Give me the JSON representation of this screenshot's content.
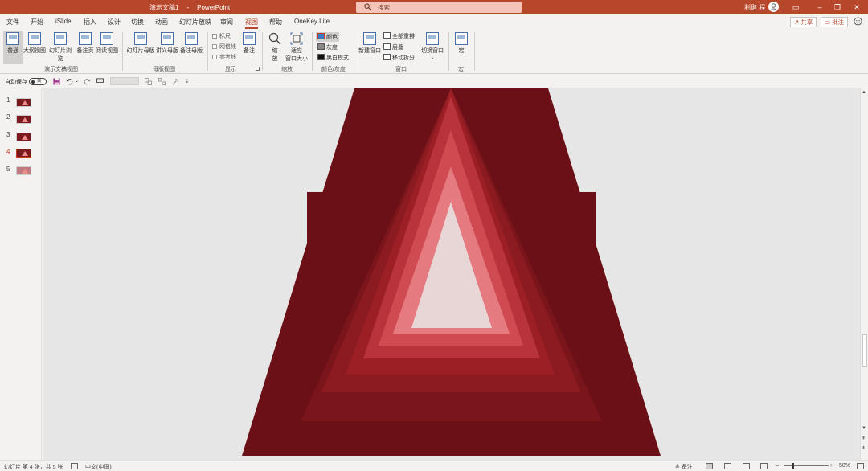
{
  "titlebar": {
    "doc_name": "演示文稿1",
    "separator": "-",
    "app_name": "PowerPoint",
    "search_placeholder": "搜索",
    "user_name": "利健 程",
    "accent": "#b7472a"
  },
  "tabs": [
    {
      "label": "文件"
    },
    {
      "label": "开始"
    },
    {
      "label": "iSlide"
    },
    {
      "label": "插入"
    },
    {
      "label": "设计"
    },
    {
      "label": "切换"
    },
    {
      "label": "动画"
    },
    {
      "label": "幻灯片放映"
    },
    {
      "label": "审阅"
    },
    {
      "label": "视图"
    },
    {
      "label": "帮助"
    },
    {
      "label": "OneKey Lite"
    }
  ],
  "active_tab": "视图",
  "share_label": "共享",
  "comment_label": "批注",
  "ribbon": {
    "presentation_views": {
      "buttons": [
        "普通",
        "大纲视图",
        "幻灯片浏览",
        "备注页",
        "阅读视图"
      ],
      "label": "演示文稿视图"
    },
    "master_views": {
      "buttons": [
        "幻灯片母版",
        "讲义母版",
        "备注母版"
      ],
      "label": "母版视图"
    },
    "show": {
      "checkboxes": [
        "标尺",
        "网格线",
        "参考线"
      ],
      "notes": "备注",
      "label": "显示"
    },
    "zoom": {
      "zoom_l1": "缩",
      "zoom_l2": "放",
      "fit_l1": "适应",
      "fit_l2": "窗口大小",
      "label": "缩放"
    },
    "color": {
      "items": [
        "颜色",
        "灰度",
        "黑白模式"
      ],
      "label": "颜色/灰度"
    },
    "window": {
      "new_window": "新建窗口",
      "items": [
        "全部重排",
        "层叠",
        "移动拆分"
      ],
      "switch": "切换窗口",
      "label": "窗口"
    },
    "macro": {
      "button": "宏",
      "label": "宏"
    }
  },
  "qat": {
    "autosave_label": "自动保存",
    "toggle_label": "关"
  },
  "slides": [
    {
      "num": "1"
    },
    {
      "num": "2"
    },
    {
      "num": "3"
    },
    {
      "num": "4"
    },
    {
      "num": "5"
    }
  ],
  "current_slide": 4,
  "statusbar": {
    "slide_info": "幻灯片 第 4 张，共 5 张",
    "language": "中文(中国)",
    "notes": "备注",
    "zoom": "50%"
  },
  "slide_colors": {
    "outer": "#6a1016",
    "layer1": "#7a151b",
    "layer2": "#8b1a21",
    "layer3": "#9c1f26",
    "layer4": "#b8333b",
    "layer5": "#d04a52",
    "layer6": "#e57b80",
    "inner": "#e8d6d6"
  }
}
